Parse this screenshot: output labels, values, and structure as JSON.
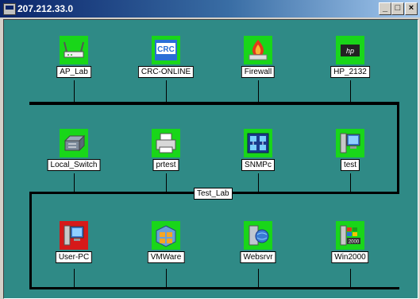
{
  "window": {
    "title": "207.212.33.0"
  },
  "network_label": "Test_Lab",
  "nodes": [
    {
      "label": "AP_Lab",
      "icon": "wireless-access-point-icon",
      "status": "up"
    },
    {
      "label": "CRC-ONLINE",
      "icon": "crc-logo-icon",
      "status": "up"
    },
    {
      "label": "Firewall",
      "icon": "firewall-icon",
      "status": "up"
    },
    {
      "label": "HP_2132",
      "icon": "hp-device-icon",
      "status": "up"
    },
    {
      "label": "Local_Switch",
      "icon": "network-switch-icon",
      "status": "up"
    },
    {
      "label": "prtest",
      "icon": "printer-icon",
      "status": "up"
    },
    {
      "label": "SNMPc",
      "icon": "snmpc-map-icon",
      "status": "up"
    },
    {
      "label": "test",
      "icon": "computer-icon",
      "status": "up"
    },
    {
      "label": "User-PC",
      "icon": "computer-icon",
      "status": "down"
    },
    {
      "label": "VMWare",
      "icon": "vmware-icon",
      "status": "up"
    },
    {
      "label": "Websrvr",
      "icon": "web-server-icon",
      "status": "up"
    },
    {
      "label": "Win2000",
      "icon": "windows-2000-icon",
      "status": "up"
    }
  ],
  "colors": {
    "background": "#2f8a86",
    "up": "#19d619",
    "down": "#d61919",
    "bus": "#000000"
  }
}
